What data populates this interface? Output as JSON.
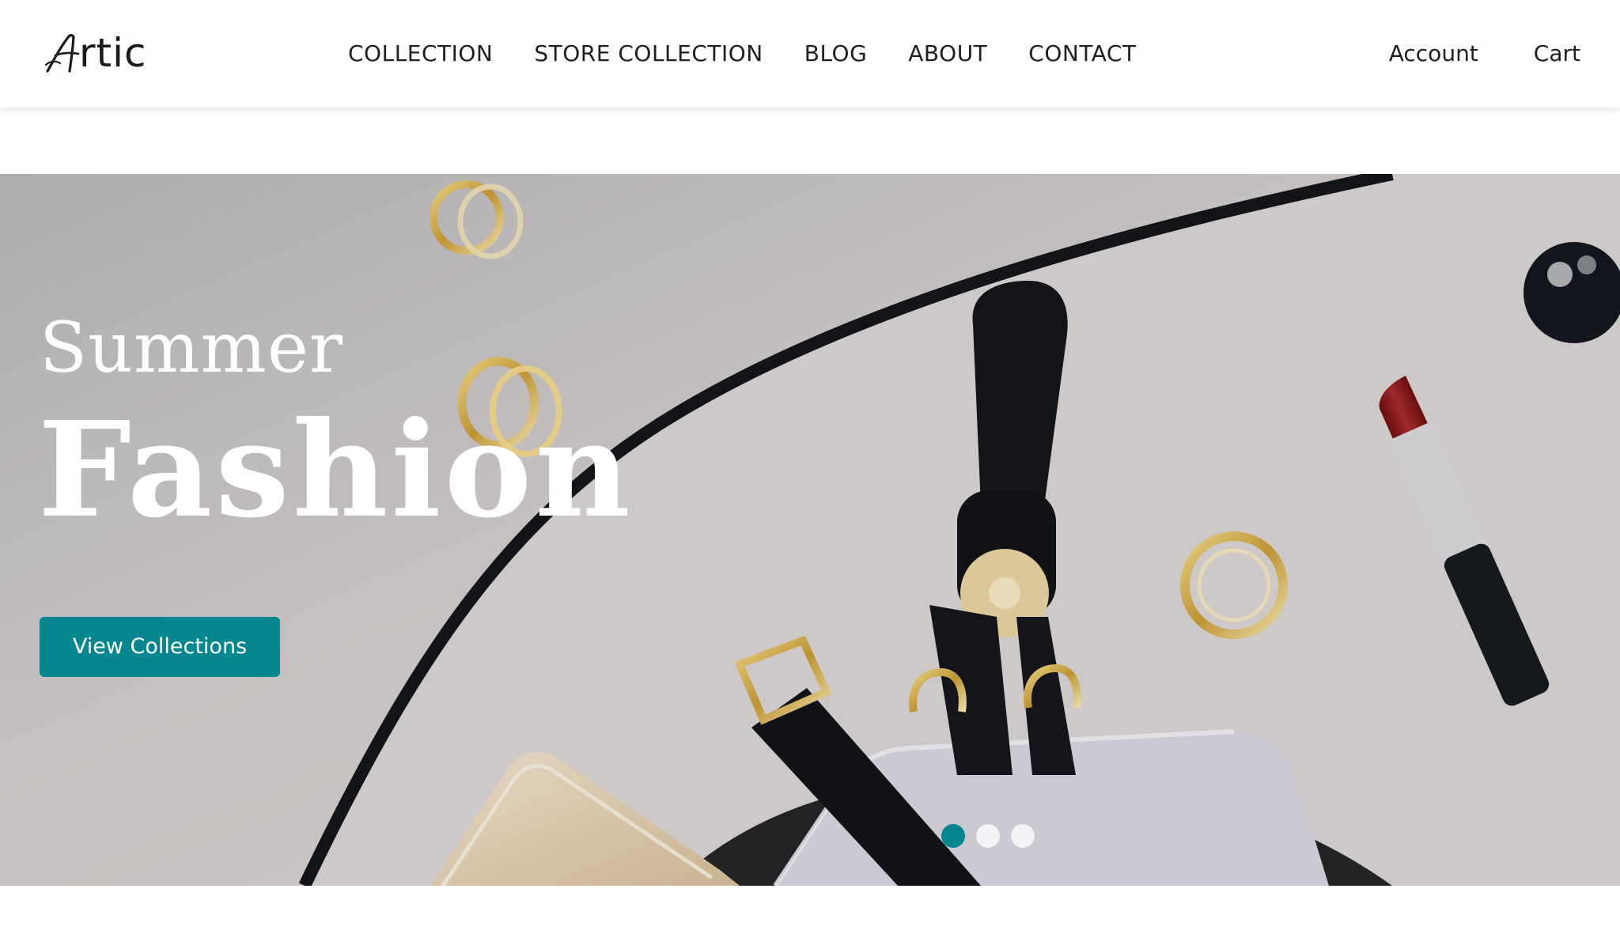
{
  "brand": {
    "logo_initial": "A",
    "logo_text": "rtic"
  },
  "nav": {
    "items": [
      {
        "label": "COLLECTION"
      },
      {
        "label": "STORE COLLECTION"
      },
      {
        "label": "BLOG"
      },
      {
        "label": "ABOUT"
      },
      {
        "label": "CONTACT"
      }
    ]
  },
  "user": {
    "account_label": "Account",
    "cart_label": "Cart"
  },
  "hero": {
    "title_small": "Summer",
    "title_large": "Fashion",
    "cta_label": "View Collections",
    "slides": {
      "count": 3,
      "active_index": 0
    }
  },
  "colors": {
    "accent": "#068790",
    "text": "#1f1f1f",
    "hero_text": "#ffffff"
  }
}
